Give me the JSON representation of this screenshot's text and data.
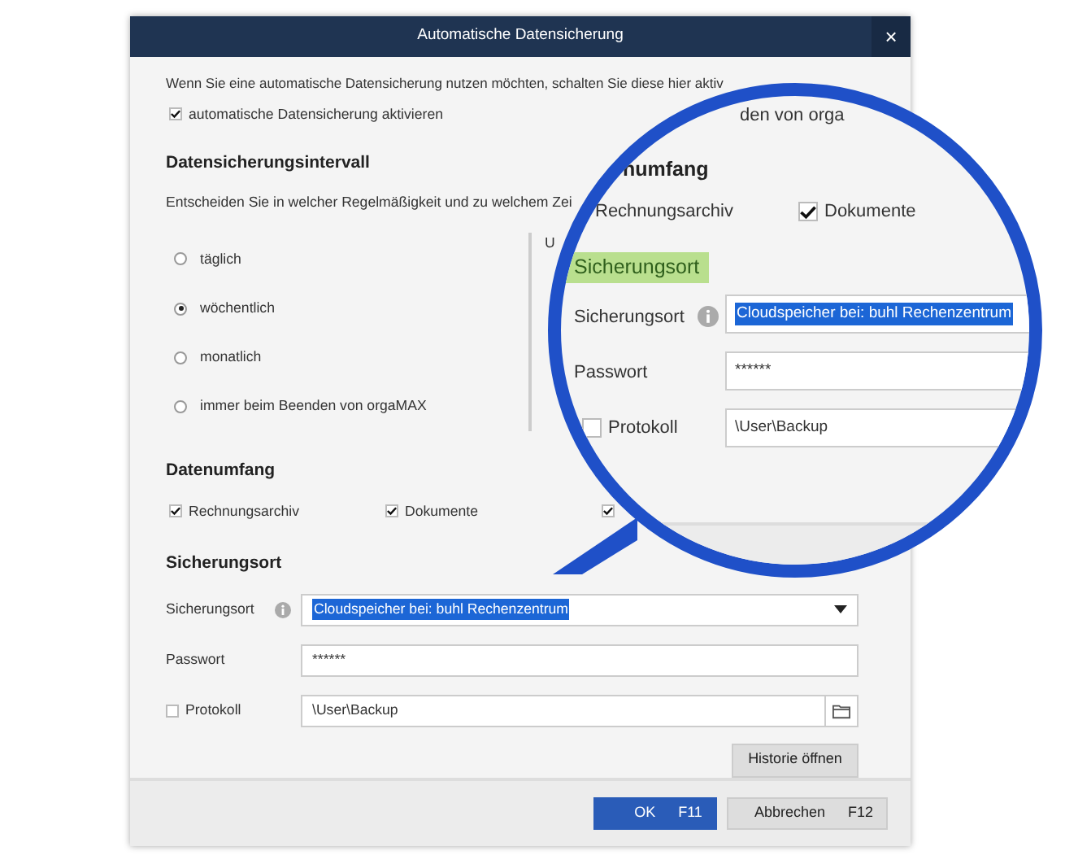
{
  "window": {
    "title": "Automatische Datensicherung",
    "close": "×"
  },
  "intro": "Wenn Sie eine automatische Datensicherung nutzen möchten, schalten Sie diese hier aktiv",
  "activate": {
    "label": "automatische Datensicherung aktivieren",
    "checked": true
  },
  "interval": {
    "heading": "Datensicherungsintervall",
    "description": "Entscheiden Sie in welcher Regelmäßigkeit und zu welchem Zei",
    "time_label": "U",
    "options": [
      {
        "label": "täglich",
        "selected": false
      },
      {
        "label": "wöchentlich",
        "selected": true
      },
      {
        "label": "monatlich",
        "selected": false
      },
      {
        "label": "immer beim Beenden von orgaMAX",
        "selected": false
      }
    ]
  },
  "scope": {
    "heading": "Datenumfang",
    "items": [
      {
        "label": "Rechnungsarchiv",
        "checked": true
      },
      {
        "label": "Dokumente",
        "checked": true
      },
      {
        "checked": true
      }
    ]
  },
  "location": {
    "heading": "Sicherungsort",
    "location_label": "Sicherungsort",
    "location_value": "Cloudspeicher bei: buhl Rechenzentrum",
    "password_label": "Passwort",
    "password_value": "******",
    "log": {
      "label": "Protokoll",
      "checked": false
    },
    "path_value": "\\User\\Backup",
    "history_button": "Historie öffnen"
  },
  "buttons": [
    {
      "label": "OK",
      "key": "F11",
      "kind": "primary"
    },
    {
      "label": "Abbrechen",
      "key": "F12",
      "kind": "secondary"
    }
  ],
  "magnifier": {
    "fragment": "den von orga",
    "scope_heading": "numfang",
    "scope_items": [
      {
        "label": "Rechnungsarchiv"
      },
      {
        "label": "Dokumente",
        "checked": true
      }
    ],
    "location_heading": "Sicherungsort",
    "location_label": "Sicherungsort",
    "location_value": "Cloudspeicher bei: buhl Rechenzentrum",
    "password_label": "Passwort",
    "password_value": "******",
    "log": {
      "label": "Protokoll",
      "checked": false
    },
    "path_value": "\\User\\Backup"
  }
}
